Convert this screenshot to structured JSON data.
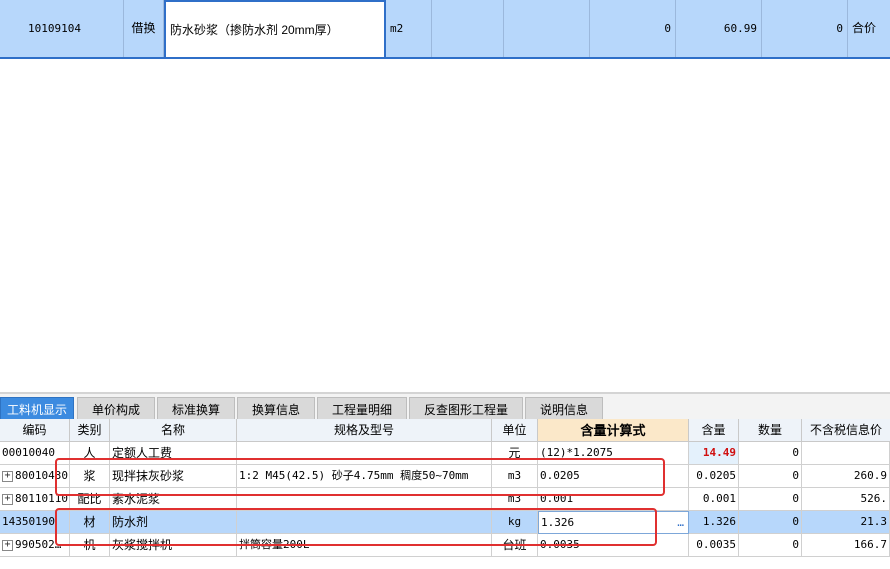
{
  "top_row": {
    "code": "10109104",
    "type": "借换",
    "name": "防水砂浆（掺防水剂 20mm厚）",
    "unit": "m2",
    "col_a": "",
    "col_b": "",
    "qty": "0",
    "price": "60.99",
    "total": "0",
    "price_type": "合价"
  },
  "tabs": [
    "工料机显示",
    "单价构成",
    "标准换算",
    "换算信息",
    "工程量明细",
    "反查图形工程量",
    "说明信息"
  ],
  "columns": [
    "编码",
    "类别",
    "名称",
    "规格及型号",
    "单位",
    "含量计算式",
    "含量",
    "数量",
    "不含税信息价"
  ],
  "rows": [
    {
      "expand": "",
      "code": "00010040",
      "type": "人",
      "name": "定额人工费",
      "spec": "",
      "unit": "元",
      "formula": "(12)*1.2075",
      "content": "14.49",
      "qty": "0",
      "price": ""
    },
    {
      "expand": "+",
      "code": "80010430",
      "type": "浆",
      "name": "现拌抹灰砂浆",
      "spec": "1:2 M45(42.5) 砂子4.75mm 稠度50~70mm",
      "unit": "m3",
      "formula": "0.0205",
      "content": "0.0205",
      "qty": "0",
      "price": "260.9"
    },
    {
      "expand": "+",
      "code": "80110110",
      "type": "配比",
      "name": "素水泥浆",
      "spec": "",
      "unit": "m3",
      "formula": "0.001",
      "content": "0.001",
      "qty": "0",
      "price": "526."
    },
    {
      "expand": "",
      "code": "14350190",
      "type": "材",
      "name": "防水剂",
      "spec": "",
      "unit": "kg",
      "formula": "1.326",
      "content": "1.326",
      "qty": "0",
      "price": "21.3",
      "ellipsis": "…"
    },
    {
      "expand": "+",
      "code": "990502…",
      "type": "机",
      "name": "灰浆搅拌机",
      "spec": "拌筒容量200L",
      "unit": "台班",
      "formula": "0.0035",
      "content": "0.0035",
      "qty": "0",
      "price": "166.7"
    }
  ],
  "colors": {
    "selected_row": "#b7d7fb",
    "active_tab": "#3c8be0",
    "highlight_value": "#d01010",
    "annotation_box": "#e03030"
  }
}
